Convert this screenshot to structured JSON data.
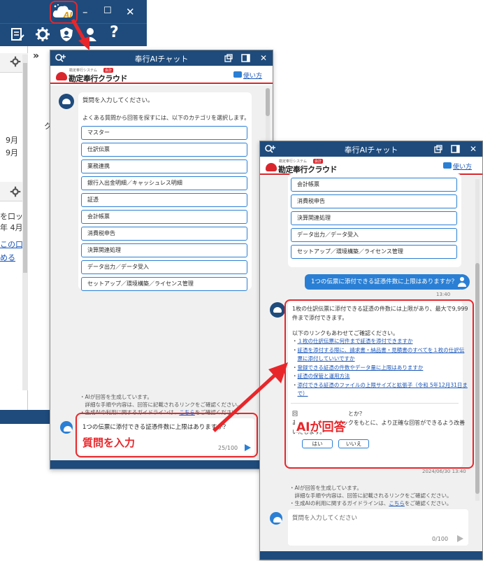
{
  "background_app": {
    "window_controls": {
      "minimize": "–",
      "maximize": "☐",
      "close": "✕"
    },
    "ai_badge": "AI",
    "left_fragments": [
      "9月",
      "9月",
      "を口ッ",
      "年 4月",
      "この口",
      "める"
    ],
    "main_fragments": [
      "»",
      "ク"
    ]
  },
  "chat_left": {
    "title": "奉行AIチャット",
    "logo_sub": "勘定奉行システム",
    "logo_main": "勘定奉行クラウド",
    "logo_tag": "会計",
    "help_label": "使い方",
    "greeting": "質問を入力してください。",
    "category_intro": "よくある質問から回答を探すには、以下のカテゴリを選択します。",
    "categories": [
      "マスター",
      "仕訳伝票",
      "業務連携",
      "銀行入出金明細／キャッシュレス明細",
      "証憑",
      "会計帳票",
      "消費税申告",
      "決算関連処理",
      "データ出力／データ受入",
      "セットアップ／環境構築／ライセンス管理"
    ],
    "greeting_time": "",
    "notes": [
      "・AIが回答を生成しています。",
      "　詳細な手順や内容は、回答に記載されるリンクをご確認ください。",
      "・生成AIの利用に関するガイドラインは、",
      "こちら",
      "をご確認ください。"
    ],
    "input_text": "1つの伝票に添付できる証憑件数に上限はありますか？",
    "counter": "25/100"
  },
  "chat_right": {
    "title": "奉行AIチャット",
    "help_label": "使い方",
    "categories_visible": [
      "会計帳票",
      "消費税申告",
      "決算関連処理",
      "データ出力／データ受入",
      "セットアップ／環境構築／ライセンス管理"
    ],
    "user_message": "1つの伝票に添付できる証憑件数に上限はありますか？",
    "user_time": "13:40",
    "answer_lines": [
      "1枚の仕訳伝票に添付できる証憑の件数には上限があり、最大で9,999",
      "件まで添付できます。"
    ],
    "links_intro": "以下のリンクもあわせてご確認ください。",
    "links": [
      "１枚の仕訳伝票に何件まで証憑を添付できますか",
      "証憑を添付する際に、請求書・納品書・見積書のすべてを１枚の仕訳伝",
      "票に添付していいですか",
      "登録できる証憑の件数やデータ量に上限はありますか",
      "証憑の保管と運用方法",
      "添付できる証憑のファイルの上限サイズと拡張子（令和 5年12月31日ま",
      "で）"
    ],
    "feedback_q_prefix": "回",
    "feedback_q_suffix": "とか？",
    "feedback_text_1": "あなたのフィードバックをもとに、より正確な回答ができるよう改善",
    "feedback_text_2": "いたします。",
    "yes_label": "はい",
    "no_label": "いいえ",
    "answer_time": "2024/06/30 13:40",
    "notes": [
      "・AIが回答を生成しています。",
      "　詳細な手順や内容は、回答に記載されるリンクをご確認ください。",
      "・生成AIの利用に関するガイドラインは、",
      "こちら",
      "をご確認ください。"
    ],
    "input_placeholder": "質問を入力してください",
    "counter": "0/100"
  },
  "callouts": {
    "input_label": "質問を入力",
    "answer_label": "AIが回答"
  },
  "colors": {
    "navy": "#1e4b7c",
    "accent_blue": "#2a7fd4",
    "callout_red": "#e8262a",
    "brand_red": "#d9262c"
  }
}
